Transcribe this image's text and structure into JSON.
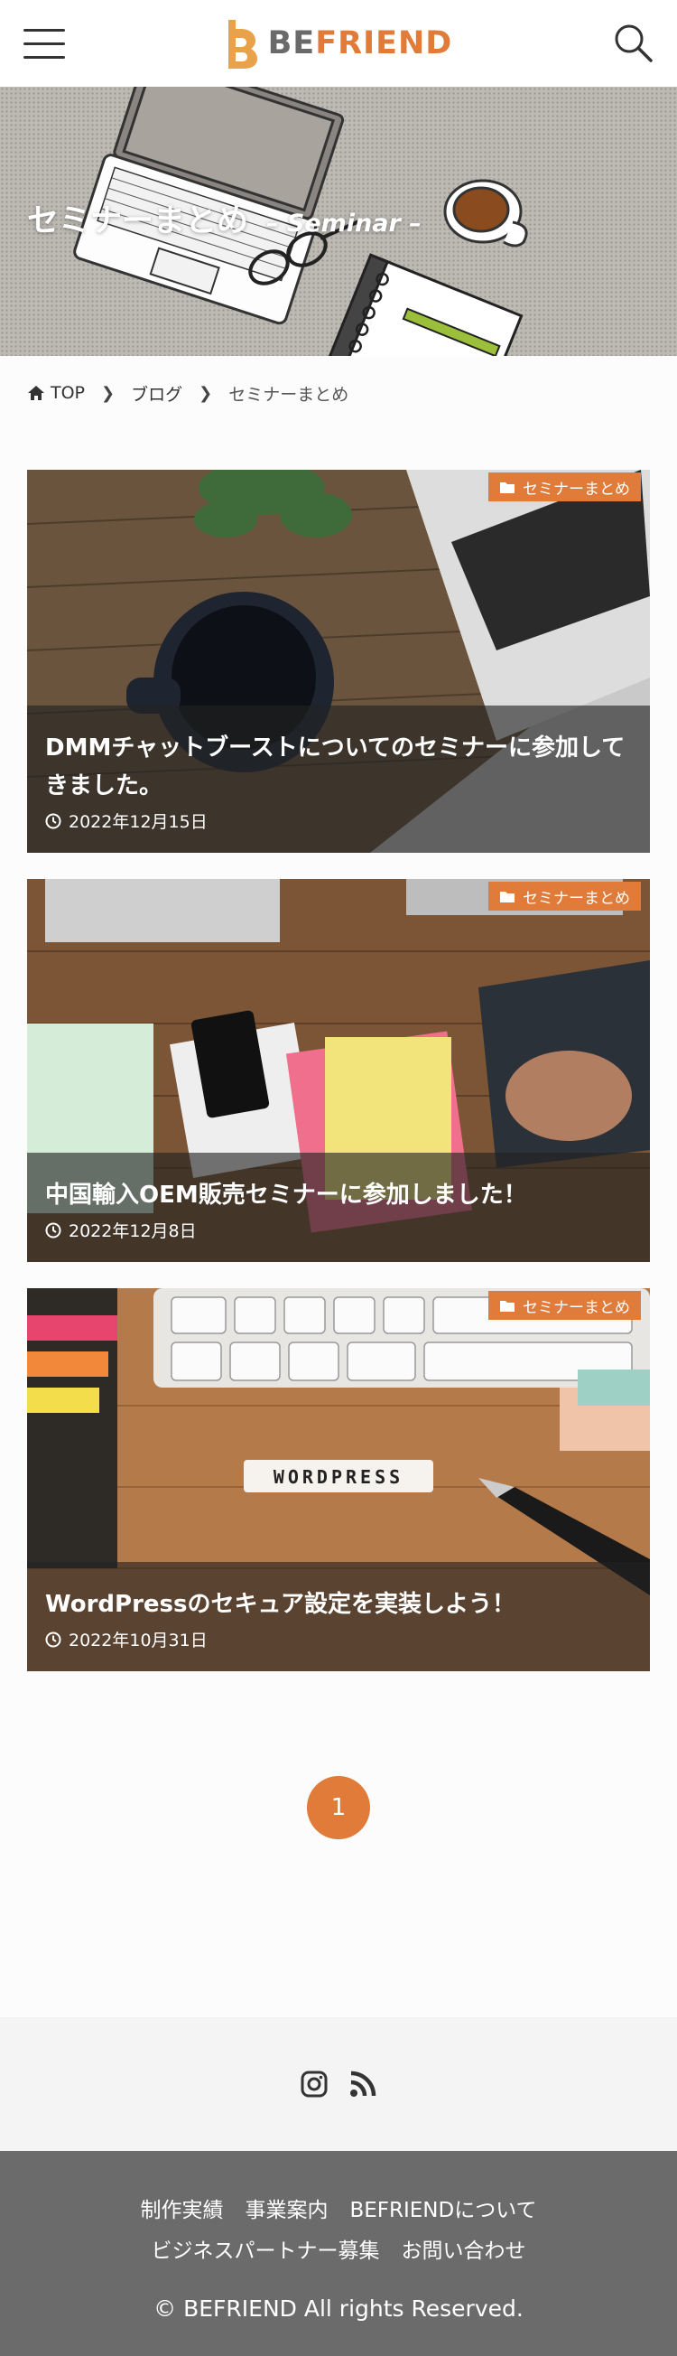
{
  "header": {
    "logo_be": "BE",
    "logo_friend": "FRIEND"
  },
  "hero": {
    "title": "セミナーまとめ",
    "subtitle": "– Seminar –"
  },
  "breadcrumb": {
    "items": [
      "TOP",
      "ブログ",
      "セミナーまとめ"
    ]
  },
  "posts": [
    {
      "category": "セミナーまとめ",
      "title": "DMMチャットブーストについてのセミナーに参加してきました。",
      "date": "2022年12月15日"
    },
    {
      "category": "セミナーまとめ",
      "title": "中国輸入OEM販売セミナーに参加しました！",
      "date": "2022年12月8日"
    },
    {
      "category": "セミナーまとめ",
      "title": "WordPressのセキュア設定を実装しよう！",
      "date": "2022年10月31日"
    }
  ],
  "pagination": {
    "current": "1"
  },
  "footer": {
    "nav_row1": [
      "制作実績",
      "事業案内",
      "BEFRIENDについて"
    ],
    "nav_row2": [
      "ビジネスパートナー募集",
      "お問い合わせ"
    ],
    "copyright": "© BEFRIEND All rights Reserved."
  },
  "colors": {
    "accent": "#e07b39",
    "footer_bg": "#6b6b6b",
    "social_bg": "#f4f4f4"
  },
  "icons": [
    "menu-icon",
    "search-icon",
    "home-icon",
    "chevron-right-icon",
    "folder-icon",
    "clock-icon",
    "instagram-icon",
    "rss-icon"
  ]
}
